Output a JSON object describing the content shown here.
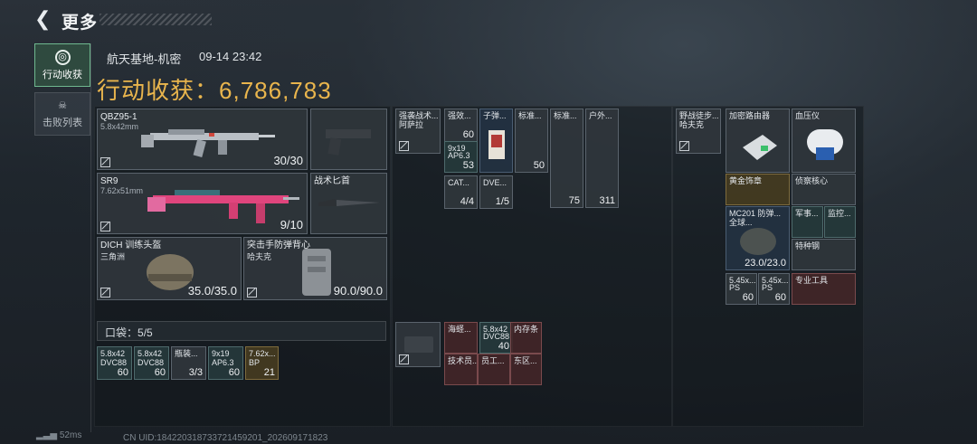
{
  "header": {
    "back_icon": "back-arrow-icon",
    "title": "更多"
  },
  "tabs": [
    {
      "label": "行动收获",
      "icon": "target-icon",
      "active": true
    },
    {
      "label": "击败列表",
      "icon": "skull-icon",
      "active": false
    }
  ],
  "raid": {
    "location": "航天基地-机密",
    "time": "09-14 23:42",
    "gain_label": "行动收获：",
    "gain_value": "6,786,783"
  },
  "equipment": {
    "primary": {
      "name": "QBZ95-1",
      "caliber": "5.8x42mm",
      "ammo": "30/30"
    },
    "secondary": {
      "name": "SR9",
      "caliber": "7.62x51mm",
      "ammo": "9/10"
    },
    "pistol": {
      "name": ""
    },
    "knife": {
      "name": "战术匕首"
    },
    "helmet": {
      "name": "DICH 训练头盔",
      "sub": "三角洲",
      "durability": "35.0/35.0"
    },
    "armor": {
      "name": "突击手防弹背心",
      "sub": "哈夫克",
      "durability": "90.0/90.0"
    }
  },
  "pocket": {
    "label": "口袋：",
    "count": "5/5",
    "items": [
      {
        "name": "5.8x42",
        "sub": "DVC88",
        "count": "60"
      },
      {
        "name": "5.8x42",
        "sub": "DVC88",
        "count": "60"
      },
      {
        "name": "瓶装...",
        "sub": "",
        "count": "3/3"
      },
      {
        "name": "9x19",
        "sub": "AP6.3",
        "count": "60"
      },
      {
        "name": "7.62x...",
        "sub": "BP",
        "count": "21"
      }
    ]
  },
  "rig": {
    "name": "强袭战术...",
    "sub": "阿萨拉"
  },
  "rig_items": [
    {
      "name": "强效...",
      "count": "60"
    },
    {
      "name": "9x19",
      "sub": "AP6.3",
      "count": "53"
    },
    {
      "name": "子弹...",
      "count": ""
    },
    {
      "name": "标准...",
      "count": "50"
    },
    {
      "name": "CAT...",
      "count": "4/4"
    },
    {
      "name": "DVE...",
      "count": "1/5"
    },
    {
      "name": "标准...",
      "count": "75"
    },
    {
      "name": "户外...",
      "count": "311"
    }
  ],
  "backpack_items": [
    {
      "name": "海蛏...",
      "count": ""
    },
    {
      "name": "5.8x42",
      "sub": "DVC88",
      "count": "40"
    },
    {
      "name": "内存条",
      "count": ""
    },
    {
      "name": "技术员...",
      "count": ""
    },
    {
      "name": "员工...",
      "count": ""
    },
    {
      "name": "东区...",
      "count": ""
    }
  ],
  "bag": {
    "name": "野战徒步...",
    "sub": "哈夫克"
  },
  "bag_items": [
    {
      "name": "加密路由器",
      "count": ""
    },
    {
      "name": "血压仪",
      "count": ""
    },
    {
      "name": "黄金饰章",
      "count": ""
    },
    {
      "name": "侦察核心",
      "count": ""
    },
    {
      "name": "MC201 防弹...",
      "sub": "全球...",
      "count": "23.0/23.0"
    },
    {
      "name": "军事...",
      "count": ""
    },
    {
      "name": "监控...",
      "count": ""
    },
    {
      "name": "特种钢",
      "count": ""
    },
    {
      "name": "5.45x...",
      "sub": "PS",
      "count": "60"
    },
    {
      "name": "5.45x...",
      "sub": "PS",
      "count": "60"
    },
    {
      "name": "专业工具",
      "count": ""
    }
  ],
  "footer": {
    "ping": "52ms",
    "uid": "CN UID:184220318733721459201_202609171823"
  }
}
